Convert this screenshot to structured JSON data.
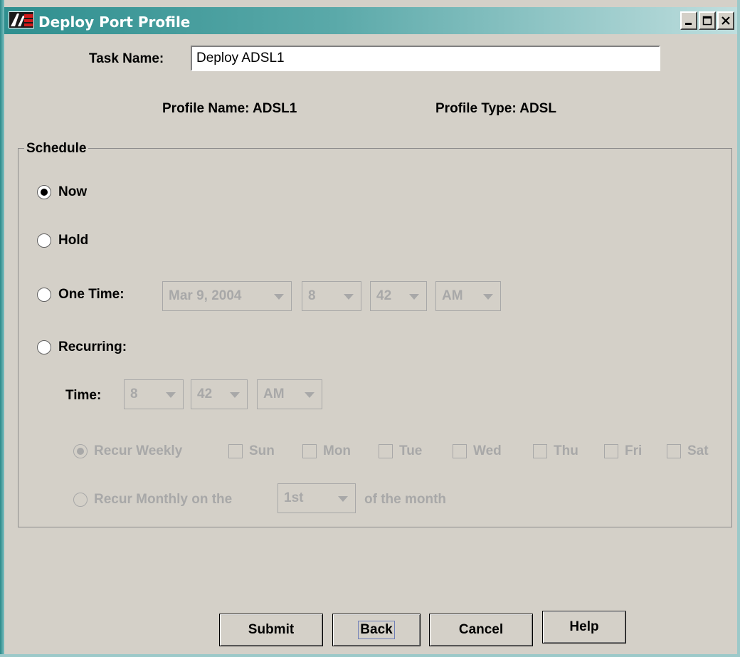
{
  "window": {
    "title": "Deploy Port Profile",
    "icon": "app-logo-icon",
    "controls": [
      "minimize-icon",
      "maximize-icon",
      "close-icon"
    ]
  },
  "task": {
    "label": "Task Name:",
    "value": "Deploy ADSL1"
  },
  "profile": {
    "name_label": "Profile Name: ADSL1",
    "type_label": "Profile Type: ADSL"
  },
  "schedule": {
    "title": "Schedule",
    "now_label": "Now",
    "hold_label": "Hold",
    "one_time": {
      "label": "One Time:",
      "date": "Mar 9, 2004",
      "hour": "8",
      "minute": "42",
      "ampm": "AM"
    },
    "recurring": {
      "label": "Recurring:",
      "time_label": "Time:",
      "hour": "8",
      "minute": "42",
      "ampm": "AM",
      "weekly_label": "Recur Weekly",
      "days": [
        "Sun",
        "Mon",
        "Tue",
        "Wed",
        "Thu",
        "Fri",
        "Sat"
      ],
      "monthly_label": "Recur Monthly on the",
      "monthly_day": "1st",
      "monthly_suffix": "of the month"
    }
  },
  "buttons": {
    "submit": "Submit",
    "back": "Back",
    "cancel": "Cancel",
    "help": "Help"
  }
}
